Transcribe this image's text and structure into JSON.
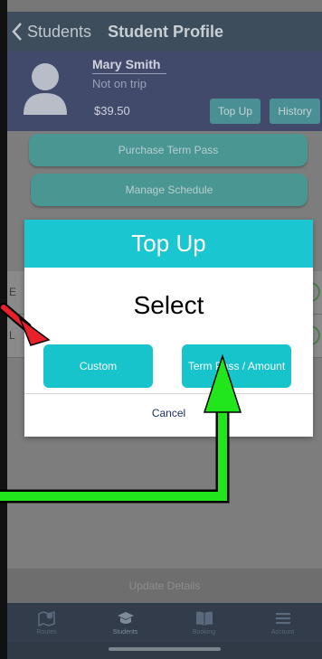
{
  "nav": {
    "back_label": "Students",
    "title": "Student Profile"
  },
  "profile": {
    "name": "Mary Smith",
    "status": "Not on trip",
    "balance": "$39.50",
    "top_up_label": "Top Up",
    "history_label": "History"
  },
  "actions": {
    "purchase_term_pass": "Purchase Term Pass",
    "manage_schedule": "Manage Schedule"
  },
  "list": {
    "row1_initial": "E",
    "row2_initial": "L"
  },
  "update_details": "Update Details",
  "dialog": {
    "title": "Top Up",
    "prompt": "Select",
    "custom_label": "Custom",
    "term_pass_label": "Term Pass / Amount",
    "cancel_label": "Cancel"
  },
  "tabs": [
    {
      "label": "Routes",
      "icon": "routes-map-icon"
    },
    {
      "label": "Students",
      "icon": "graduation-cap-icon"
    },
    {
      "label": "Booking",
      "icon": "book-icon"
    },
    {
      "label": "Account",
      "icon": "menu-icon"
    }
  ],
  "colors": {
    "dialog_accent": "#1ac6d0",
    "arrow_red": "#e8202a",
    "arrow_green": "#22e61c"
  }
}
